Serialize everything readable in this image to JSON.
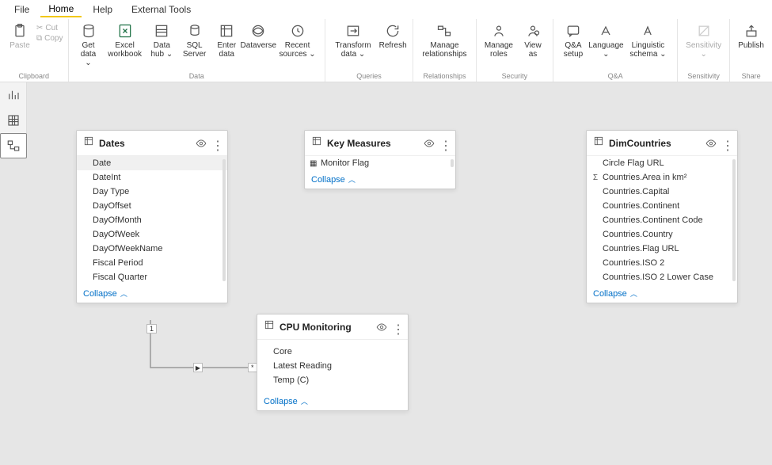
{
  "menubar": {
    "items": [
      "File",
      "Home",
      "Help",
      "External Tools"
    ],
    "activeIndex": 1
  },
  "ribbon": {
    "groups": [
      {
        "label": "Clipboard",
        "buttons": [
          {
            "type": "paste",
            "label": "Paste",
            "icon": "paste-icon",
            "disabled": true
          },
          {
            "type": "cut",
            "label": "Cut",
            "icon": "cut-icon",
            "disabled": true
          },
          {
            "type": "copy",
            "label": "Copy",
            "icon": "copy-icon",
            "disabled": true
          }
        ]
      },
      {
        "label": "Data",
        "buttons": [
          {
            "label": "Get\ndata ⌄",
            "icon": "getdata-icon"
          },
          {
            "label": "Excel\nworkbook",
            "icon": "excel-icon"
          },
          {
            "label": "Data\nhub ⌄",
            "icon": "datahub-icon"
          },
          {
            "label": "SQL\nServer",
            "icon": "sql-icon"
          },
          {
            "label": "Enter\ndata",
            "icon": "enterdata-icon"
          },
          {
            "label": "Dataverse",
            "icon": "dataverse-icon"
          },
          {
            "label": "Recent\nsources ⌄",
            "icon": "recent-icon"
          }
        ]
      },
      {
        "label": "Queries",
        "buttons": [
          {
            "label": "Transform\ndata ⌄",
            "icon": "transform-icon"
          },
          {
            "label": "Refresh",
            "icon": "refresh-icon"
          }
        ]
      },
      {
        "label": "Relationships",
        "buttons": [
          {
            "label": "Manage\nrelationships",
            "icon": "relationship-icon"
          }
        ]
      },
      {
        "label": "Security",
        "buttons": [
          {
            "label": "Manage\nroles",
            "icon": "roles-icon"
          },
          {
            "label": "View\nas",
            "icon": "viewas-icon"
          }
        ]
      },
      {
        "label": "Q&A",
        "buttons": [
          {
            "label": "Q&A\nsetup",
            "icon": "qa-icon"
          },
          {
            "label": "Language\n⌄",
            "icon": "language-icon"
          },
          {
            "label": "Linguistic\nschema ⌄",
            "icon": "linguistic-icon"
          }
        ]
      },
      {
        "label": "Sensitivity",
        "buttons": [
          {
            "label": "Sensitivity\n⌄",
            "icon": "sensitivity-icon",
            "disabled": true
          }
        ]
      },
      {
        "label": "Share",
        "buttons": [
          {
            "label": "Publish",
            "icon": "publish-icon"
          }
        ]
      }
    ]
  },
  "leftrail": {
    "items": [
      {
        "name": "report-view-icon"
      },
      {
        "name": "data-view-icon"
      },
      {
        "name": "model-view-icon"
      }
    ],
    "activeIndex": 2
  },
  "tables": {
    "dates": {
      "title": "Dates",
      "fields": [
        "Date",
        "DateInt",
        "Day Type",
        "DayOffset",
        "DayOfMonth",
        "DayOfWeek",
        "DayOfWeekName",
        "Fiscal Period",
        "Fiscal Quarter"
      ],
      "selected": "Date",
      "collapse": "Collapse"
    },
    "keymeasures": {
      "title": "Key Measures",
      "fields": [
        "Monitor Flag"
      ],
      "collapse": "Collapse"
    },
    "dimcountries": {
      "title": "DimCountries",
      "fields": [
        "Circle Flag URL",
        "Countries.Area in km²",
        "Countries.Capital",
        "Countries.Continent",
        "Countries.Continent Code",
        "Countries.Country",
        "Countries.Flag URL",
        "Countries.ISO 2",
        "Countries.ISO 2 Lower Case"
      ],
      "sigma_field": "Countries.Area in km²",
      "collapse": "Collapse"
    },
    "cpumonitoring": {
      "title": "CPU Monitoring",
      "fields": [
        "Core",
        "Latest Reading",
        "Temp (C)"
      ],
      "collapse": "Collapse"
    }
  },
  "relationship": {
    "from_card": "Dates",
    "to_card": "CPU Monitoring",
    "from_cardinality": "1",
    "to_cardinality": "*",
    "direction": "single"
  }
}
